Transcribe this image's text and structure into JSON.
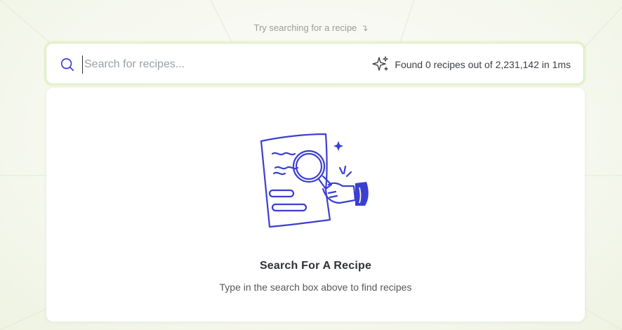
{
  "hint": {
    "text": "Try searching for a recipe",
    "arrow": "↴"
  },
  "search": {
    "placeholder": "Search for recipes...",
    "value": "",
    "status": "Found 0 recipes out of 2,231,142 in 1ms"
  },
  "empty_state": {
    "title": "Search For A Recipe",
    "subtitle": "Type in the search box above to find recipes"
  },
  "icons": {
    "search": "search-icon",
    "sparkle": "sparkle-icon",
    "illustration": "document-magnifier-illustration"
  },
  "colors": {
    "accent": "#3b3fd0",
    "search_border": "#d6ebb2",
    "background": "#f7f9f2"
  }
}
